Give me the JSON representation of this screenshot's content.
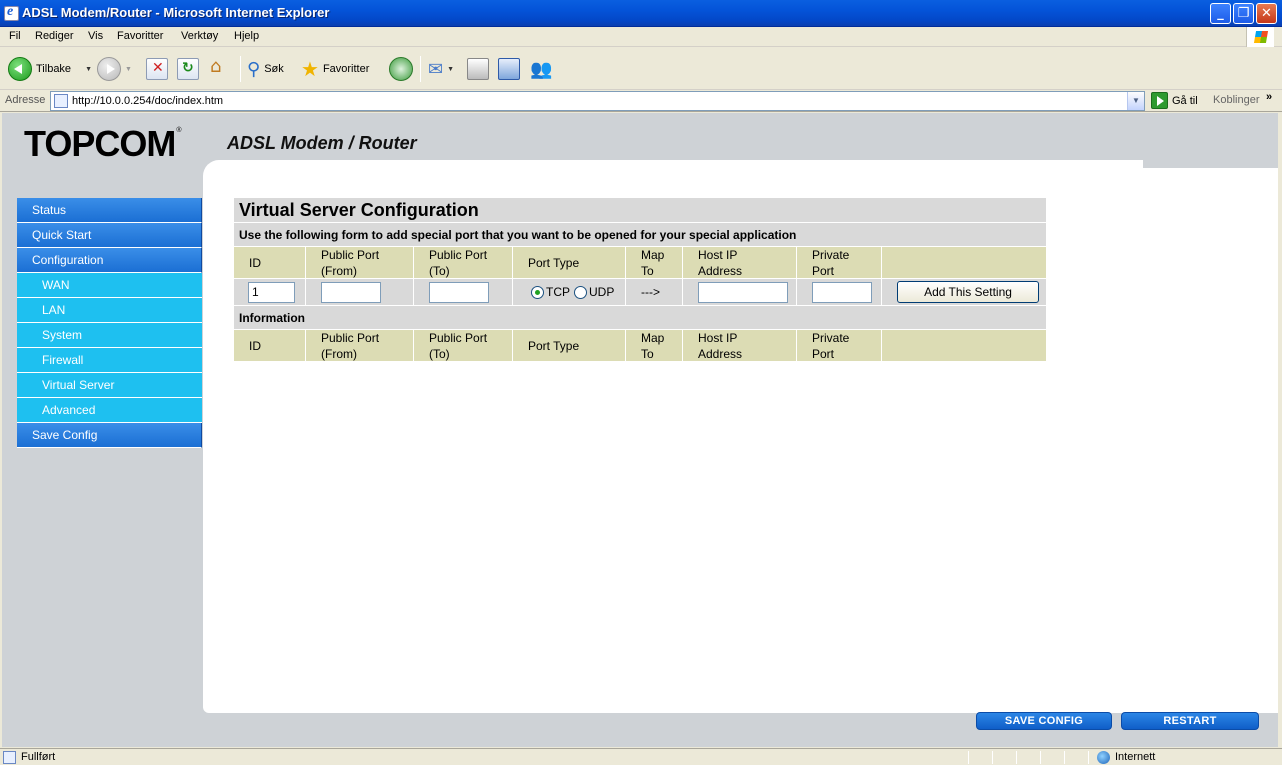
{
  "window": {
    "title": "ADSL Modem/Router - Microsoft Internet Explorer",
    "minimize": "_",
    "restore": "❐",
    "close": "✕"
  },
  "menu": [
    "Fil",
    "Rediger",
    "Vis",
    "Favoritter",
    "Verktøy",
    "Hjelp"
  ],
  "toolbar": {
    "back_label": "Tilbake",
    "search_label": "Søk",
    "favorites_label": "Favoritter"
  },
  "address": {
    "label": "Adresse",
    "url": "http://10.0.0.254/doc/index.htm",
    "go_label": "Gå til",
    "links_label": "Koblinger",
    "links_chevron": "»"
  },
  "page": {
    "logo": "TOPCOM",
    "logo_mark": "®",
    "product": "ADSL Modem / Router",
    "nav": [
      {
        "label": "Status",
        "level": "main"
      },
      {
        "label": "Quick Start",
        "level": "main"
      },
      {
        "label": "Configuration",
        "level": "main"
      },
      {
        "label": "WAN",
        "level": "sub"
      },
      {
        "label": "LAN",
        "level": "sub"
      },
      {
        "label": "System",
        "level": "sub"
      },
      {
        "label": "Firewall",
        "level": "sub"
      },
      {
        "label": "Virtual Server",
        "level": "sub"
      },
      {
        "label": "Advanced",
        "level": "sub"
      },
      {
        "label": "Save Config",
        "level": "main"
      }
    ],
    "form": {
      "title": "Virtual Server Configuration",
      "description": "Use the following form to add special port that you want to be opened for your special application",
      "headers": {
        "id": "ID",
        "from_1": "Public Port",
        "from_2": "(From)",
        "to_1": "Public Port",
        "to_2": "(To)",
        "type": "Port Type",
        "map_1": "Map",
        "map_2": "To",
        "host_1": "Host IP",
        "host_2": "Address",
        "priv_1": "Private",
        "priv_2": "Port"
      },
      "id_value": "1",
      "public_from_value": "",
      "public_to_value": "",
      "tcp_label": "TCP",
      "udp_label": "UDP",
      "selected_port_type": "TCP",
      "map_arrow": "--->",
      "host_ip_value": "",
      "private_port_value": "",
      "add_button": "Add This Setting",
      "info_title": "Information"
    },
    "save_config_button": "SAVE CONFIG",
    "restart_button": "RESTART"
  },
  "status": {
    "text": "Fullført",
    "zone": "Internett"
  }
}
